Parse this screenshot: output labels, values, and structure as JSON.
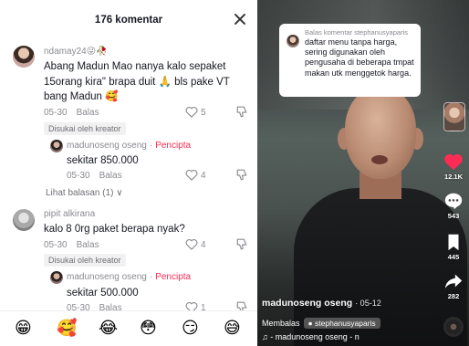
{
  "comments_panel": {
    "title": "176 komentar",
    "comments": [
      {
        "username": "ndamay24😜🥀",
        "text": "Abang Madun Mao nanya kalo sepaket 15orang kira\" brapa duit 🙏 bls pake VT bang Madun 🥰",
        "date": "05-30",
        "reply_label": "Balas",
        "likes": "5",
        "badge": "Disukai oleh kreator",
        "reply": {
          "username": "madunoseng oseng",
          "creator_label": "Pencipta",
          "text": "sekitar 850.000",
          "date": "05-30",
          "reply_label": "Balas",
          "likes": "4"
        },
        "view_replies": "Lihat balasan (1) ∨"
      },
      {
        "username": "pipit alkirana",
        "text": "kalo 8 0rg paket berapa nyak?",
        "date": "05-30",
        "reply_label": "Balas",
        "likes": "4",
        "badge": "Disukai oleh kreator",
        "reply": {
          "username": "madunoseng oseng",
          "creator_label": "Pencipta",
          "text": "sekitar 500.000",
          "date": "05-30",
          "reply_label": "Balas",
          "likes": "1"
        }
      }
    ],
    "emojis": [
      "😁",
      "🥰",
      "😂",
      "😳",
      "😏",
      "😅"
    ]
  },
  "video_panel": {
    "reply_card": {
      "header": "Balas komentar stephanusyaparis",
      "text": "daftar menu tanpa harga, sering digunakan oleh pengusaha di beberapa tmpat makan utk menggetok harga."
    },
    "side_actions": {
      "likes": "12.1K",
      "comments": "543",
      "saves": "445",
      "shares": "282"
    },
    "author": "madunoseng oseng",
    "post_date": "· 05-12",
    "membalas_label": "Membalas",
    "membalas_target": "● stephanusyaparis",
    "music": "♫ - madunoseng oseng - n",
    "colors": {
      "like_red": "#fe2c55",
      "creator_red": "#fe2c55",
      "text_gray": "#8a8b91"
    }
  }
}
